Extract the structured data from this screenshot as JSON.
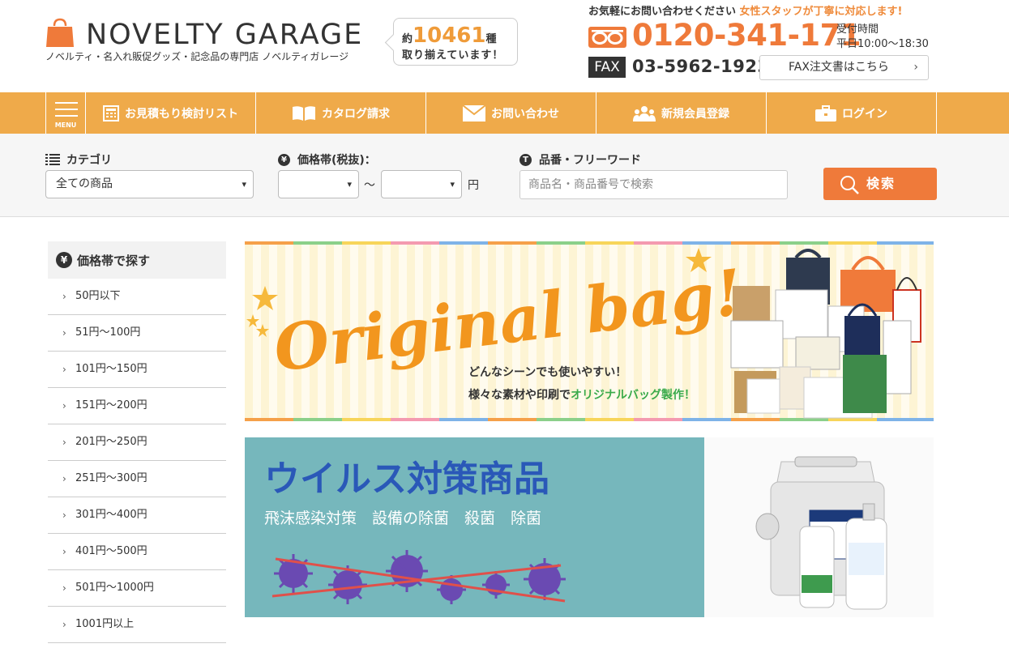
{
  "header": {
    "logo_text": "NOVELTY GARAGE",
    "tagline": "ノベルティ・名入れ販促グッズ・記念品の専門店 ノベルティガレージ",
    "count_prefix": "約",
    "count_number": "10461",
    "count_suffix": "種",
    "count_line2": "取り揃えています！",
    "contact_lead": "お気軽にお問い合わせください",
    "contact_highlight": "女性スタッフが丁寧に対応します!",
    "phone": "0120-341-171",
    "hours_label": "受付時間",
    "hours_value": "平日10:00〜18:30",
    "fax_badge": "FAX",
    "fax_number": "03-5962-1923",
    "fax_button": "FAX注文書はこちら"
  },
  "nav": {
    "menu_label": "MENU",
    "items": [
      {
        "label": "お見積もり検討リスト",
        "icon": "calculator-icon"
      },
      {
        "label": "カタログ請求",
        "icon": "book-icon"
      },
      {
        "label": "お問い合わせ",
        "icon": "mail-icon"
      },
      {
        "label": "新規会員登録",
        "icon": "users-icon"
      },
      {
        "label": "ログイン",
        "icon": "briefcase-icon"
      }
    ]
  },
  "search": {
    "category_label": "カテゴリ",
    "category_value": "全ての商品",
    "price_label": "価格帯(税抜)：",
    "price_from": "",
    "price_to": "",
    "price_tilde": "〜",
    "price_unit": "円",
    "keyword_label": "品番・フリーワード",
    "keyword_placeholder": "商品名・商品番号で検索",
    "button": "検索"
  },
  "sidebar": {
    "title": "価格帯で探す",
    "items": [
      "50円以下",
      "51円〜100円",
      "101円〜150円",
      "151円〜200円",
      "201円〜250円",
      "251円〜300円",
      "301円〜400円",
      "401円〜500円",
      "501円〜1000円",
      "1001円以上"
    ]
  },
  "banner_bag": {
    "headline": "Original bag!",
    "line1": "どんなシーンでも使いやすい！",
    "line2_prefix": "様々な素材や印刷で",
    "line2_highlight": "オリジナルバッグ製作！"
  },
  "banner_virus": {
    "title": "ウイルス対策商品",
    "subtitle": "飛沫感染対策　設備の除菌　殺菌　除菌"
  },
  "colors": {
    "accent": "#efaa4a",
    "orange": "#ef7a3a",
    "virus_bg": "#76b7bc",
    "virus_title": "#2a58b8"
  }
}
